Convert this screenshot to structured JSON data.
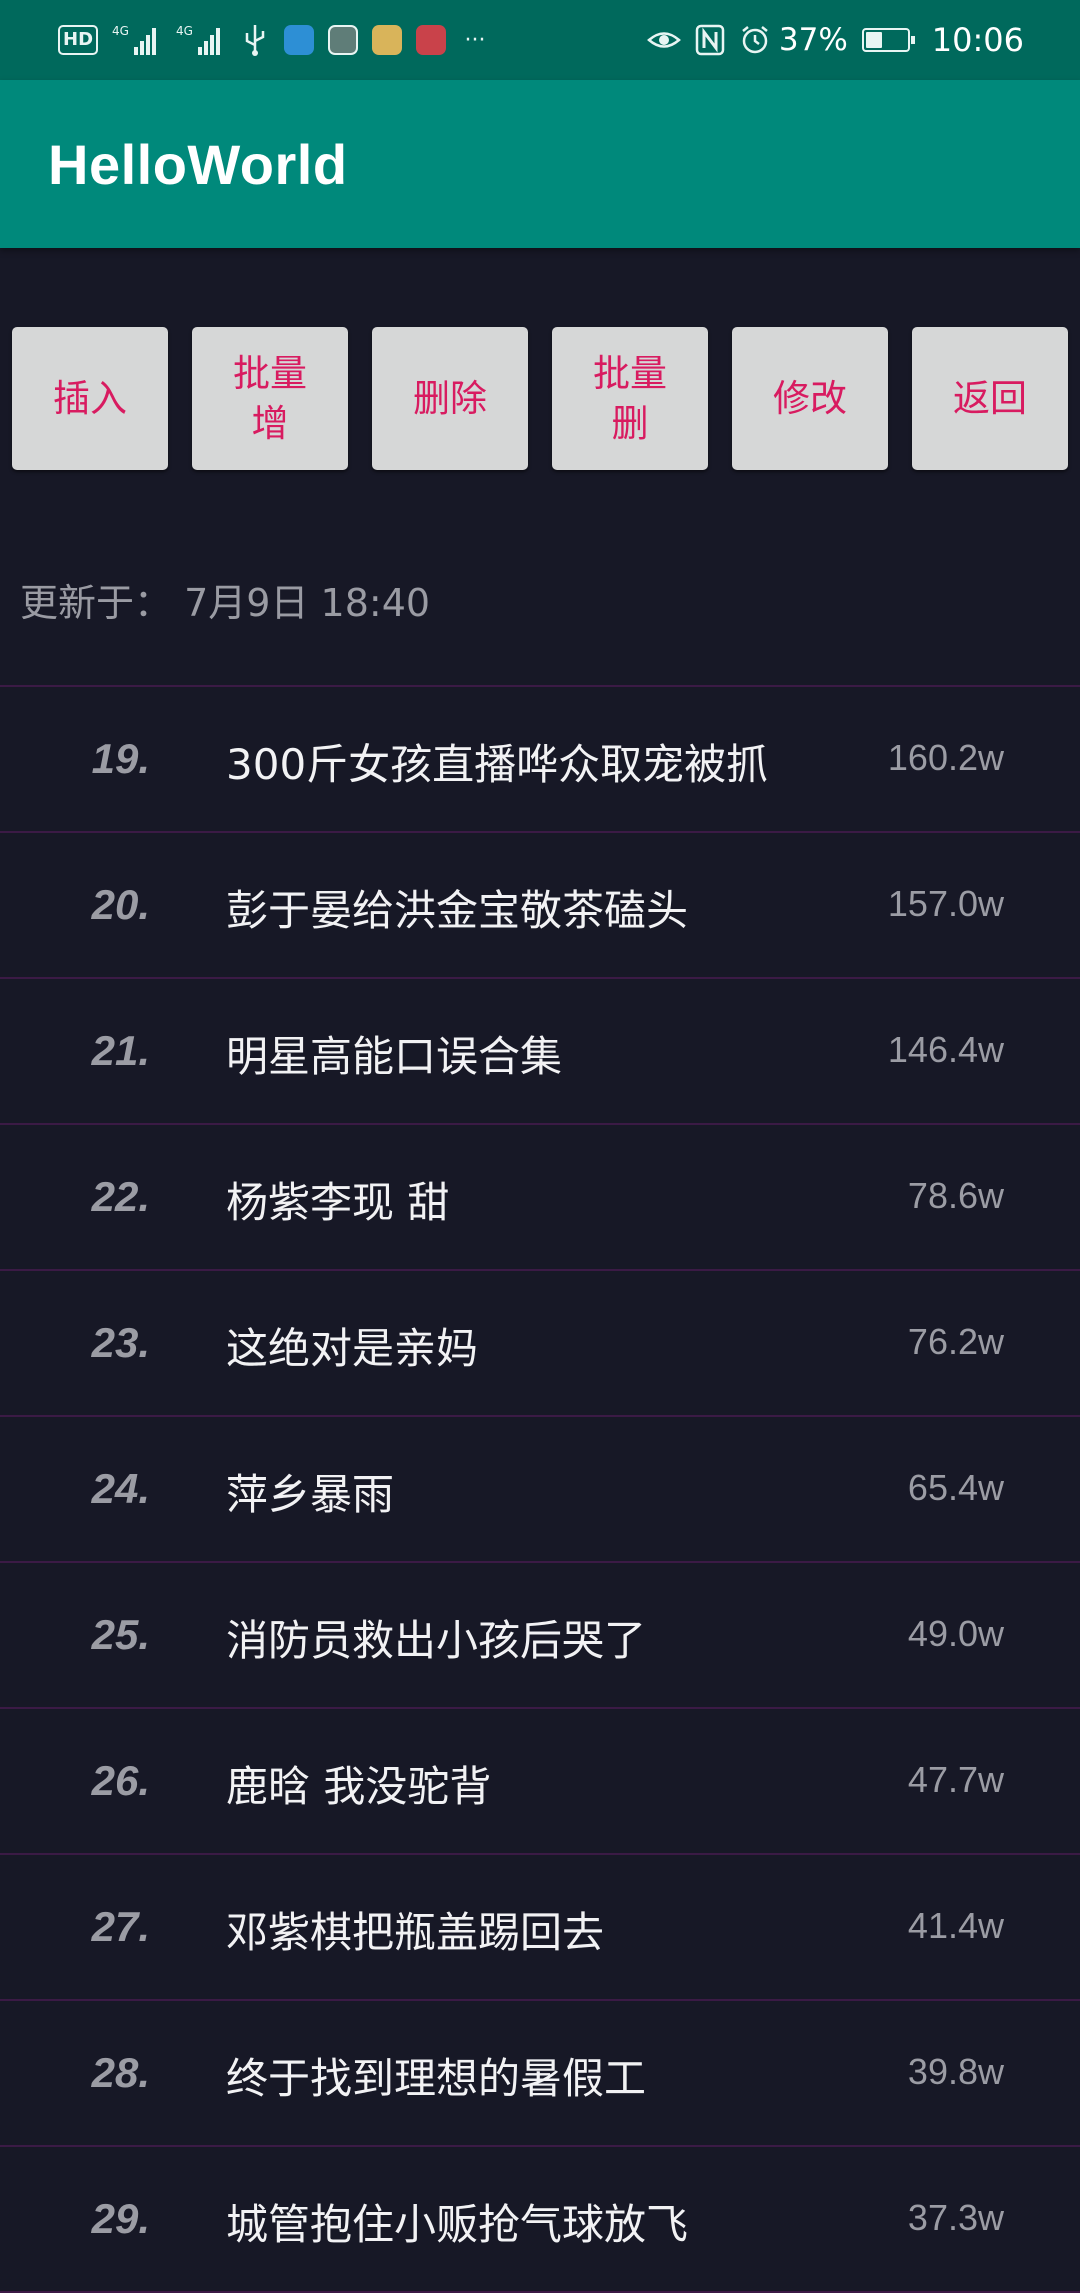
{
  "status_bar": {
    "hd_label": "HD",
    "signal1_label": "4G",
    "signal2_label": "4G",
    "battery_percent": "37%",
    "battery_level": 0.37,
    "time": "10:06",
    "more_label": "···",
    "left_icons": [
      "hd-icon",
      "signal-4g-icon",
      "signal-4g-icon",
      "usb-icon",
      "app-notification-icon",
      "app-notification-icon",
      "app-notification-icon",
      "app-notification-icon",
      "more-icon"
    ],
    "right_icons": [
      "eye-icon",
      "nfc-icon",
      "alarm-icon",
      "battery-charging-icon"
    ]
  },
  "app_bar": {
    "title": "HelloWorld",
    "color": "#00897b"
  },
  "toolbar": {
    "buttons": [
      {
        "label": "插入"
      },
      {
        "label": "批量增"
      },
      {
        "label": "删除"
      },
      {
        "label": "批量删"
      },
      {
        "label": "修改"
      },
      {
        "label": "返回"
      }
    ],
    "text_color": "#d81b60"
  },
  "updated": {
    "label": "更新于：",
    "value": "7月9日 18:40"
  },
  "list": {
    "rows": [
      {
        "rank": "19.",
        "title": "300斤女孩直播哗众取宠被抓",
        "count": "160.2w"
      },
      {
        "rank": "20.",
        "title": "彭于晏给洪金宝敬茶磕头",
        "count": "157.0w"
      },
      {
        "rank": "21.",
        "title": "明星高能口误合集",
        "count": "146.4w"
      },
      {
        "rank": "22.",
        "title": "杨紫李现 甜",
        "count": "78.6w"
      },
      {
        "rank": "23.",
        "title": "这绝对是亲妈",
        "count": "76.2w"
      },
      {
        "rank": "24.",
        "title": "萍乡暴雨",
        "count": "65.4w"
      },
      {
        "rank": "25.",
        "title": "消防员救出小孩后哭了",
        "count": "49.0w"
      },
      {
        "rank": "26.",
        "title": "鹿晗 我没驼背",
        "count": "47.7w"
      },
      {
        "rank": "27.",
        "title": "邓紫棋把瓶盖踢回去",
        "count": "41.4w"
      },
      {
        "rank": "28.",
        "title": "终于找到理想的暑假工",
        "count": "39.8w"
      },
      {
        "rank": "29.",
        "title": "城管抱住小贩抢气球放飞",
        "count": "37.3w"
      }
    ]
  }
}
